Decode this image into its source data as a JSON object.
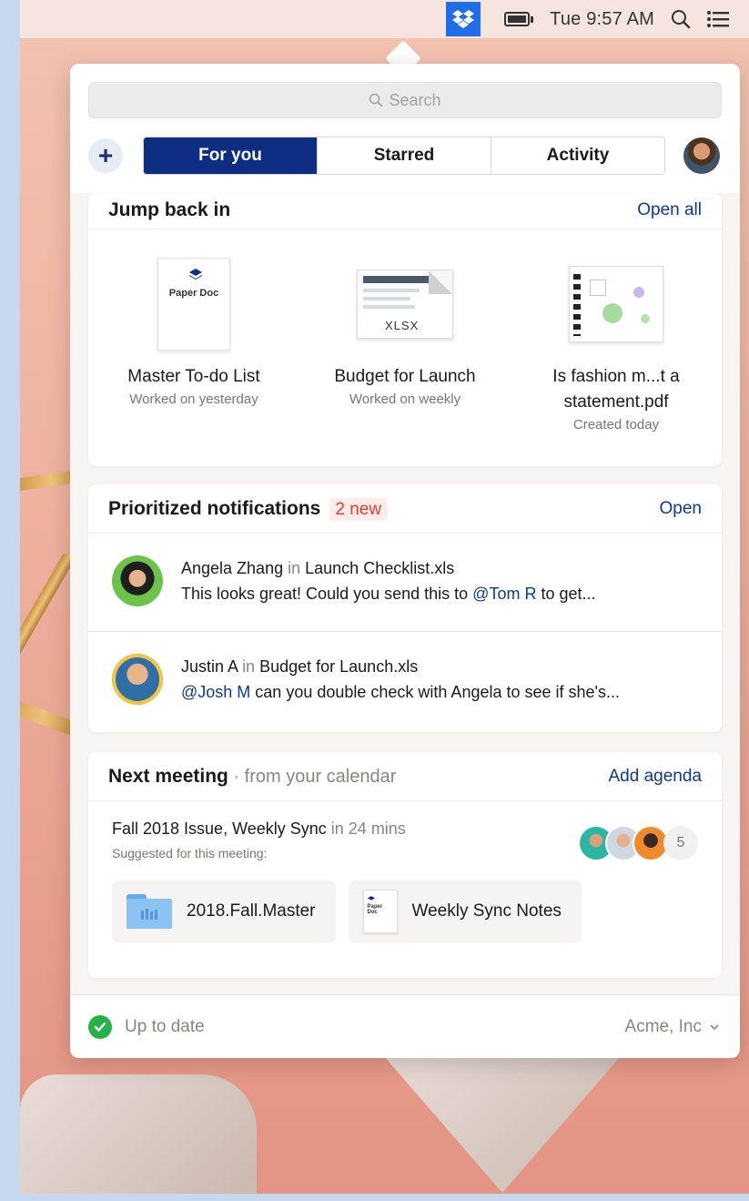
{
  "menubar": {
    "time": "Tue 9:57 AM",
    "icons": [
      "dropbox-icon",
      "battery-icon",
      "search-icon",
      "list-icon"
    ]
  },
  "panel": {
    "search_placeholder": "Search",
    "tabs": [
      {
        "label": "For you",
        "active": true
      },
      {
        "label": "Starred",
        "active": false
      },
      {
        "label": "Activity",
        "active": false
      }
    ],
    "add_label": "+"
  },
  "jump_back_in": {
    "title": "Jump back in",
    "action": "Open all",
    "files": [
      {
        "name": "Master To-do List",
        "meta": "Worked on yesterday",
        "thumb_label": "Paper Doc",
        "icon": "paper-doc-icon"
      },
      {
        "name": "Budget for Launch",
        "meta": "Worked on weekly",
        "thumb_label": "XLSX",
        "icon": "xlsx-icon"
      },
      {
        "name": "Is fashion m...t a statement.pdf",
        "meta": "Created today",
        "icon": "pdf-icon"
      }
    ]
  },
  "notifications": {
    "title": "Prioritized notifications",
    "badge": "2 new",
    "action": "Open",
    "items": [
      {
        "who": "Angela Zhang",
        "in": "in",
        "file": "Launch Checklist.xls",
        "mention": "@Tom R",
        "message_pre": "This looks great! Could you send this to ",
        "message_post": " to get..."
      },
      {
        "who": "Justin A",
        "in": "in",
        "file": "Budget for Launch.xls",
        "mention": "@Josh M",
        "message_pre": "",
        "message_post": " can you double check with Angela to see if she's..."
      }
    ]
  },
  "meeting": {
    "title": "Next meeting",
    "subtitle": " · from your calendar",
    "action": "Add agenda",
    "event_name": "Fall 2018 Issue, Weekly Sync",
    "event_time": " in 24 mins",
    "suggested": "Suggested for this meeting:",
    "attendee_count": "5",
    "chips": [
      {
        "label": "2018.Fall.Master",
        "icon": "folder-icon"
      },
      {
        "label": "Weekly Sync Notes",
        "icon": "paper-doc-icon",
        "thumb_label": "Paper Doc"
      }
    ]
  },
  "footer": {
    "status": "Up to date",
    "team": "Acme, Inc"
  },
  "colors": {
    "accent": "#0c2d82",
    "link": "#0c3a8f",
    "badge": "#e03e2d",
    "success": "#27b149",
    "dropbox_blue": "#1f6ee8"
  }
}
